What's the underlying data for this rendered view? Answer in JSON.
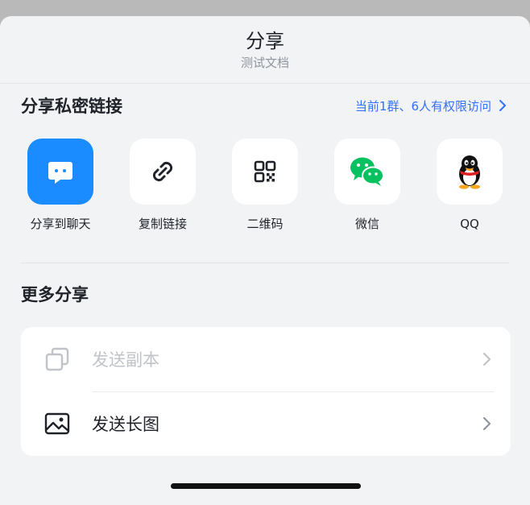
{
  "header": {
    "title": "分享",
    "subtitle": "测试文档"
  },
  "private_link": {
    "title": "分享私密链接",
    "access_text": "当前1群、6人有权限访问",
    "items": [
      {
        "label": "分享到聊天",
        "icon": "chat-bubble-icon"
      },
      {
        "label": "复制链接",
        "icon": "link-icon"
      },
      {
        "label": "二维码",
        "icon": "qr-code-icon"
      },
      {
        "label": "微信",
        "icon": "wechat-icon"
      },
      {
        "label": "QQ",
        "icon": "qq-penguin-icon"
      }
    ]
  },
  "more_share": {
    "title": "更多分享",
    "items": [
      {
        "label": "发送副本",
        "icon": "copy-icon",
        "disabled": true
      },
      {
        "label": "发送长图",
        "icon": "image-icon",
        "disabled": false
      }
    ]
  },
  "colors": {
    "accent": "#3370ff",
    "chat_blue": "#1a8cff",
    "wechat_green": "#07c160"
  }
}
